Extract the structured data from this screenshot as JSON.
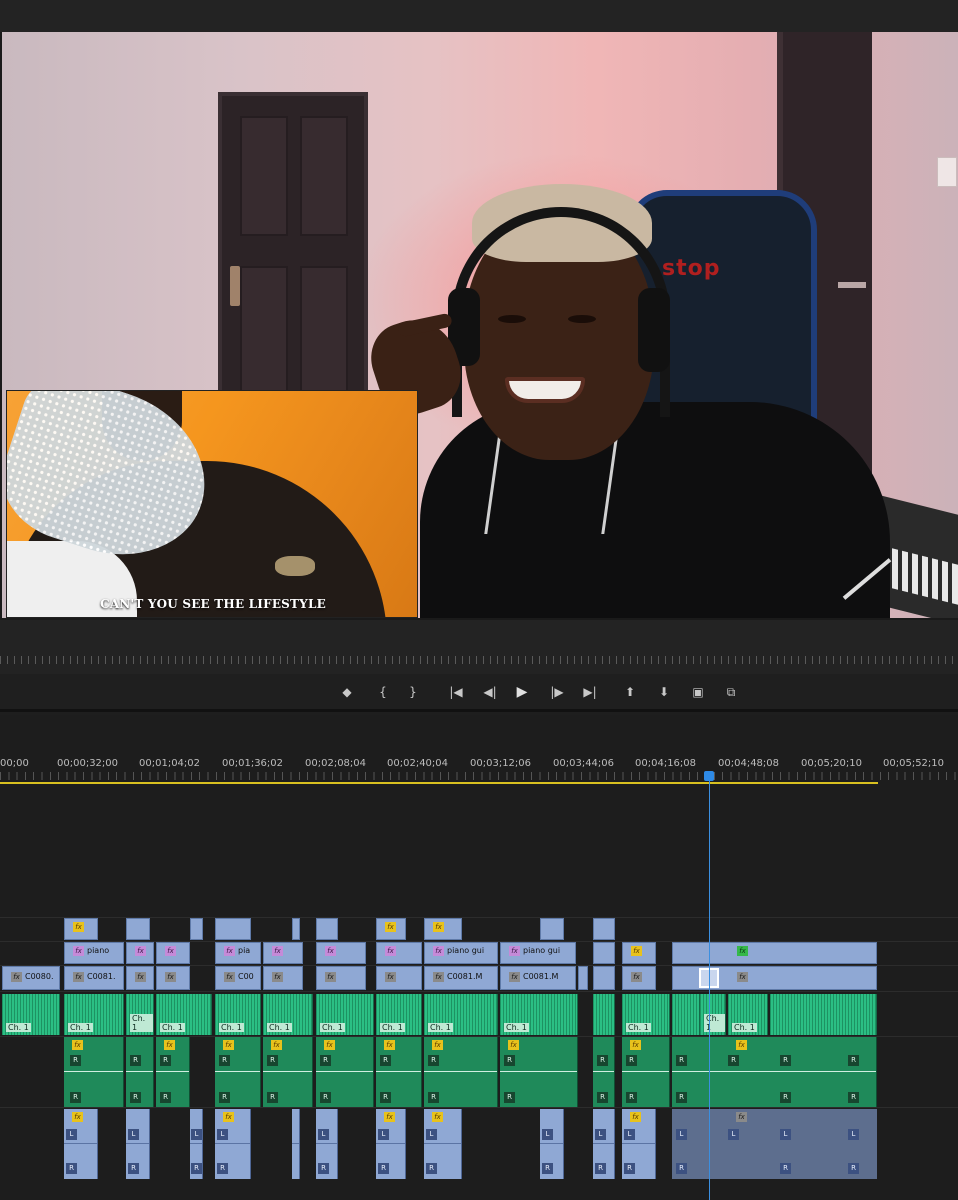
{
  "program_monitor": {
    "inset_caption": "CAN'T YOU SEE THE LIFESTYLE",
    "chair_brand": "stop"
  },
  "transport": {
    "buttons": [
      {
        "name": "add-marker-button",
        "glyph": "◆"
      },
      {
        "name": "mark-in-button",
        "glyph": "{"
      },
      {
        "name": "mark-out-button",
        "glyph": "}"
      },
      {
        "name": "go-to-in-button",
        "glyph": "|◀"
      },
      {
        "name": "step-back-button",
        "glyph": "◀|"
      },
      {
        "name": "play-button",
        "glyph": "▶"
      },
      {
        "name": "step-forward-button",
        "glyph": "|▶"
      },
      {
        "name": "go-to-out-button",
        "glyph": "▶|"
      },
      {
        "name": "lift-button",
        "glyph": "⬆"
      },
      {
        "name": "extract-button",
        "glyph": "⬇"
      },
      {
        "name": "export-frame-button",
        "glyph": "▣"
      },
      {
        "name": "compare-view-button",
        "glyph": "⧉"
      }
    ]
  },
  "timeline": {
    "timecodes": [
      "00;00",
      "00;00;32;00",
      "00;01;04;02",
      "00;01;36;02",
      "00;02;08;04",
      "00;02;40;04",
      "00;03;12;06",
      "00;03;44;06",
      "00;04;16;08",
      "00;04;48;08",
      "00;05;20;10",
      "00;05;52;10"
    ],
    "v1_labels": [
      "C0080.",
      "C0081.",
      "C00",
      "C0081.M",
      "C0081.M"
    ],
    "v2_labels": [
      "piano",
      "pia",
      "piano gui",
      "piano gui"
    ],
    "audio_label": "Ch. 1",
    "badge_fx": "fx",
    "badge_l": "L",
    "badge_r": "R"
  },
  "colors": {
    "video_clip": "#8fa8d4",
    "audio_clip": "#2bbf84",
    "audio_clip_dark": "#1f8a5a",
    "playhead": "#3b8fe0",
    "work_area": "#d8c020",
    "fx_badge": "#e8c21c"
  }
}
